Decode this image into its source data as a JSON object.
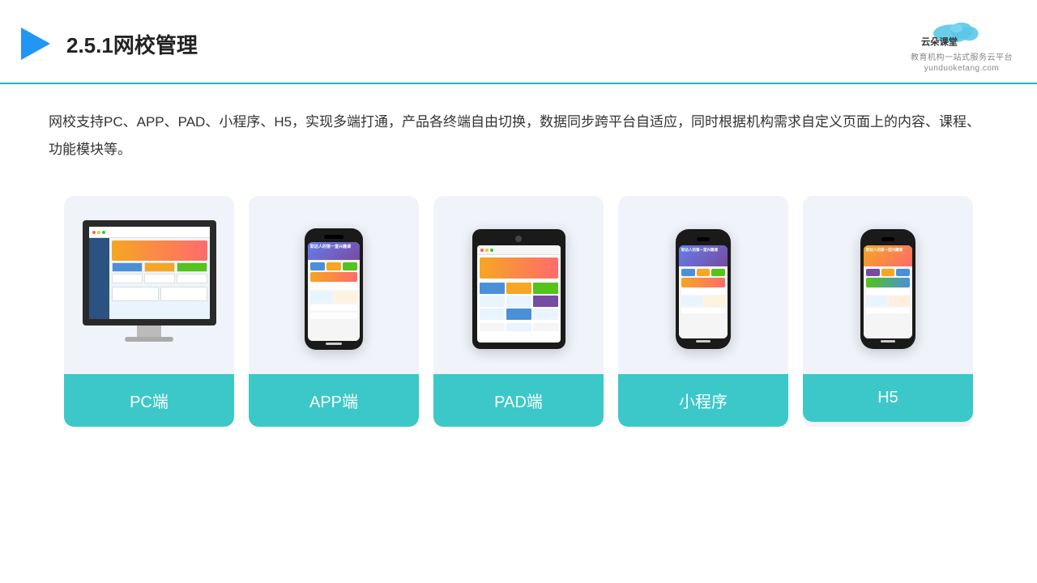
{
  "header": {
    "title": "2.5.1网校管理",
    "logo_name": "云朵课堂",
    "logo_url": "yunduoketang.com",
    "logo_tagline": "教育机构一站式服务云平台"
  },
  "description": {
    "text": "网校支持PC、APP、PAD、小程序、H5，实现多端打通，产品各终端自由切换，数据同步跨平台自适应，同时根据机构需求自定义页面上的内容、课程、功能模块等。"
  },
  "cards": [
    {
      "id": "pc",
      "label": "PC端"
    },
    {
      "id": "app",
      "label": "APP端"
    },
    {
      "id": "pad",
      "label": "PAD端"
    },
    {
      "id": "miniprogram",
      "label": "小程序"
    },
    {
      "id": "h5",
      "label": "H5"
    }
  ],
  "colors": {
    "accent": "#3cc8c8",
    "header_border": "#1cb8c8",
    "card_bg": "#f0f4fa",
    "card_label_bg": "#3cc8c8"
  }
}
